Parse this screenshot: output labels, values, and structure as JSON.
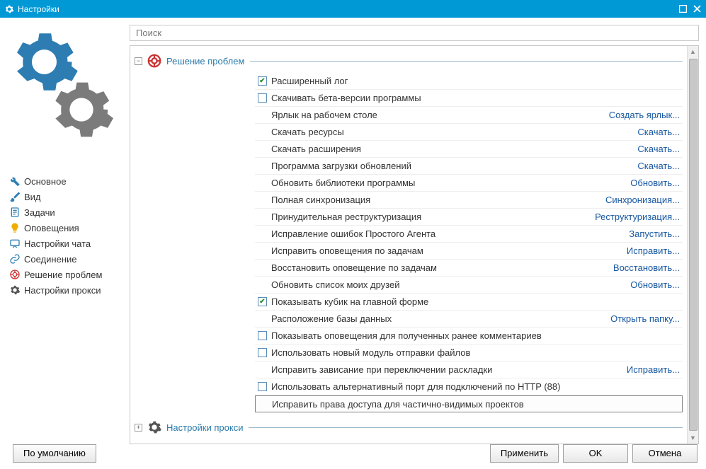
{
  "title": "Настройки",
  "search": {
    "placeholder": "Поиск"
  },
  "sidebar": {
    "items": [
      {
        "label": "Основное"
      },
      {
        "label": "Вид"
      },
      {
        "label": "Задачи"
      },
      {
        "label": "Оповещения"
      },
      {
        "label": "Настройки чата"
      },
      {
        "label": "Соединение"
      },
      {
        "label": "Решение проблем"
      },
      {
        "label": "Настройки прокси"
      }
    ]
  },
  "sections": {
    "troubleshoot": {
      "title": "Решение проблем"
    },
    "proxy": {
      "title": "Настройки прокси"
    }
  },
  "rows": [
    {
      "type": "check",
      "checked": true,
      "label": "Расширенный лог"
    },
    {
      "type": "check",
      "checked": false,
      "label": "Скачивать бета-версии программы"
    },
    {
      "type": "action",
      "label": "Ярлык на рабочем столе",
      "action": "Создать ярлык..."
    },
    {
      "type": "action",
      "label": "Скачать ресурсы",
      "action": "Скачать..."
    },
    {
      "type": "action",
      "label": "Скачать расширения",
      "action": "Скачать..."
    },
    {
      "type": "action",
      "label": "Программа загрузки обновлений",
      "action": "Скачать..."
    },
    {
      "type": "action",
      "label": "Обновить библиотеки программы",
      "action": "Обновить..."
    },
    {
      "type": "action",
      "label": "Полная синхронизация",
      "action": "Синхронизация..."
    },
    {
      "type": "action",
      "label": "Принудительная реструктуризация",
      "action": "Реструктуризация..."
    },
    {
      "type": "action",
      "label": "Исправление ошибок Простого Агента",
      "action": "Запустить..."
    },
    {
      "type": "action",
      "label": "Исправить оповещения по задачам",
      "action": "Исправить..."
    },
    {
      "type": "action",
      "label": "Восстановить оповещение по задачам",
      "action": "Восстановить..."
    },
    {
      "type": "action",
      "label": "Обновить список моих друзей",
      "action": "Обновить..."
    },
    {
      "type": "check",
      "checked": true,
      "label": "Показывать кубик на главной форме"
    },
    {
      "type": "action",
      "label": "Расположение базы данных",
      "action": "Открыть папку..."
    },
    {
      "type": "check",
      "checked": false,
      "label": "Показывать оповещения для полученных ранее комментариев"
    },
    {
      "type": "check",
      "checked": false,
      "label": "Использовать новый модуль отправки файлов"
    },
    {
      "type": "action",
      "label": "Исправить зависание при переключении раскладки",
      "action": "Исправить..."
    },
    {
      "type": "check",
      "checked": false,
      "label": "Использовать альтернативный порт для подключений по HTTP (88)"
    },
    {
      "type": "plain",
      "label": "Исправить права доступа для частично-видимых проектов",
      "selected": true
    }
  ],
  "footer": {
    "defaults": "По умолчанию",
    "apply": "Применить",
    "ok": "OK",
    "cancel": "Отмена"
  }
}
